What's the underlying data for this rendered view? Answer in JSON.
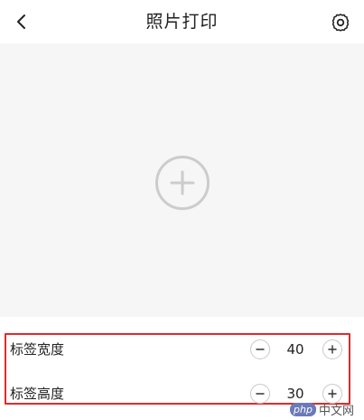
{
  "header": {
    "title": "照片打印",
    "back_icon": "chevron-left-icon",
    "settings_icon": "gear-icon"
  },
  "preview": {
    "add_icon": "add-circle-icon"
  },
  "label_settings": {
    "width": {
      "label": "标签宽度",
      "value": "40"
    },
    "height": {
      "label": "标签高度",
      "value": "30"
    }
  },
  "watermark": {
    "badge": "php",
    "text": "中文网"
  },
  "colors": {
    "highlight": "#e02b2b",
    "preview_bg": "#f6f6f7",
    "icon_gray": "#cccccc"
  }
}
